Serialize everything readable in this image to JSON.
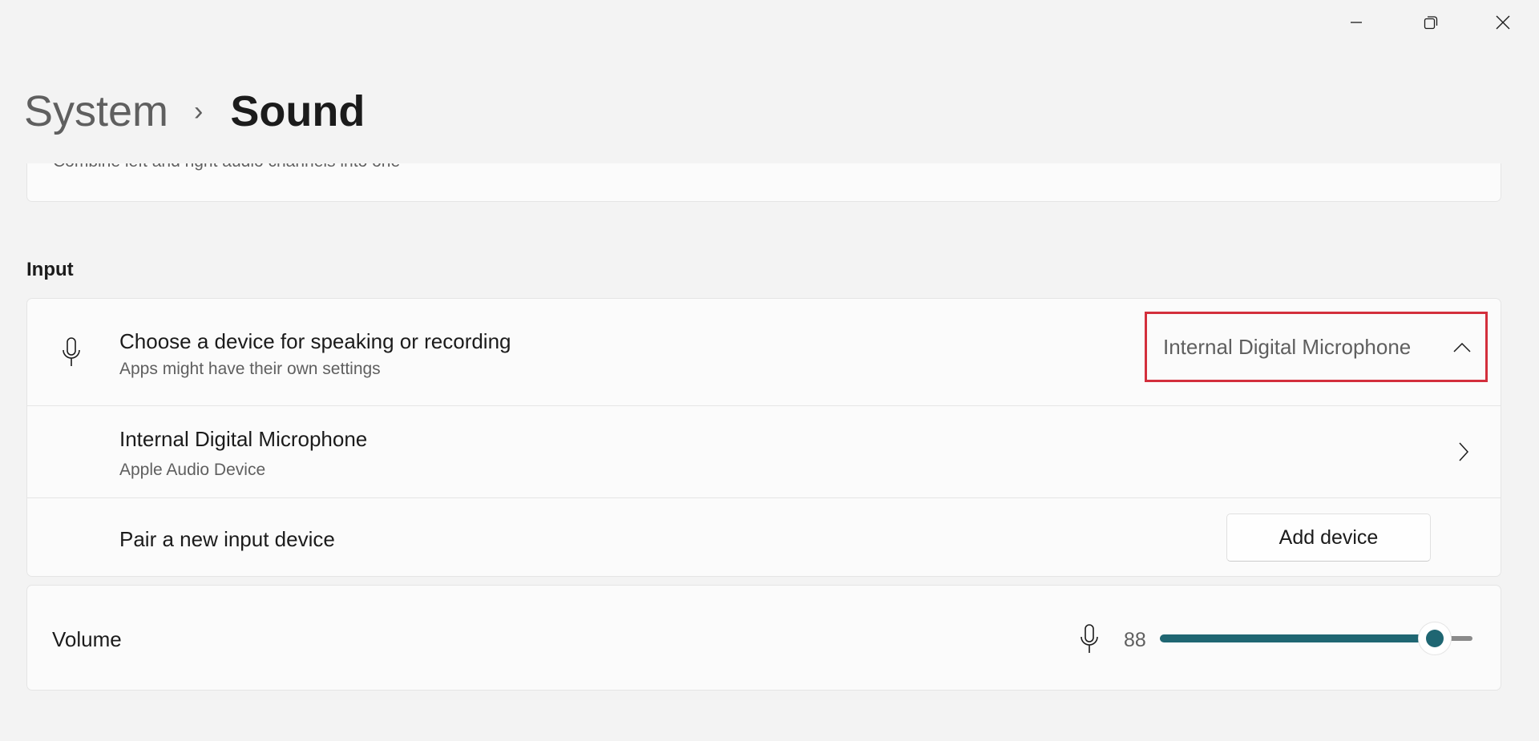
{
  "window": {
    "minimize_icon": "minimize-icon",
    "restore_icon": "restore-icon",
    "close_icon": "close-icon"
  },
  "breadcrumb": {
    "parent": "System",
    "separator": "›",
    "current": "Sound"
  },
  "mono_card": {
    "description": "Combine left and right audio channels into one"
  },
  "input": {
    "section_title": "Input",
    "choose": {
      "title": "Choose a device for speaking or recording",
      "subtitle": "Apps might have their own settings",
      "selected": "Internal Digital Microphone"
    },
    "device": {
      "name": "Internal Digital Microphone",
      "subtitle": "Apple Audio Device"
    },
    "pair": {
      "label": "Pair a new input device",
      "button": "Add device"
    }
  },
  "volume": {
    "label": "Volume",
    "value": "88",
    "level_percent": 88,
    "accent": "#1f6672",
    "highlight_color": "#d32f3c"
  }
}
